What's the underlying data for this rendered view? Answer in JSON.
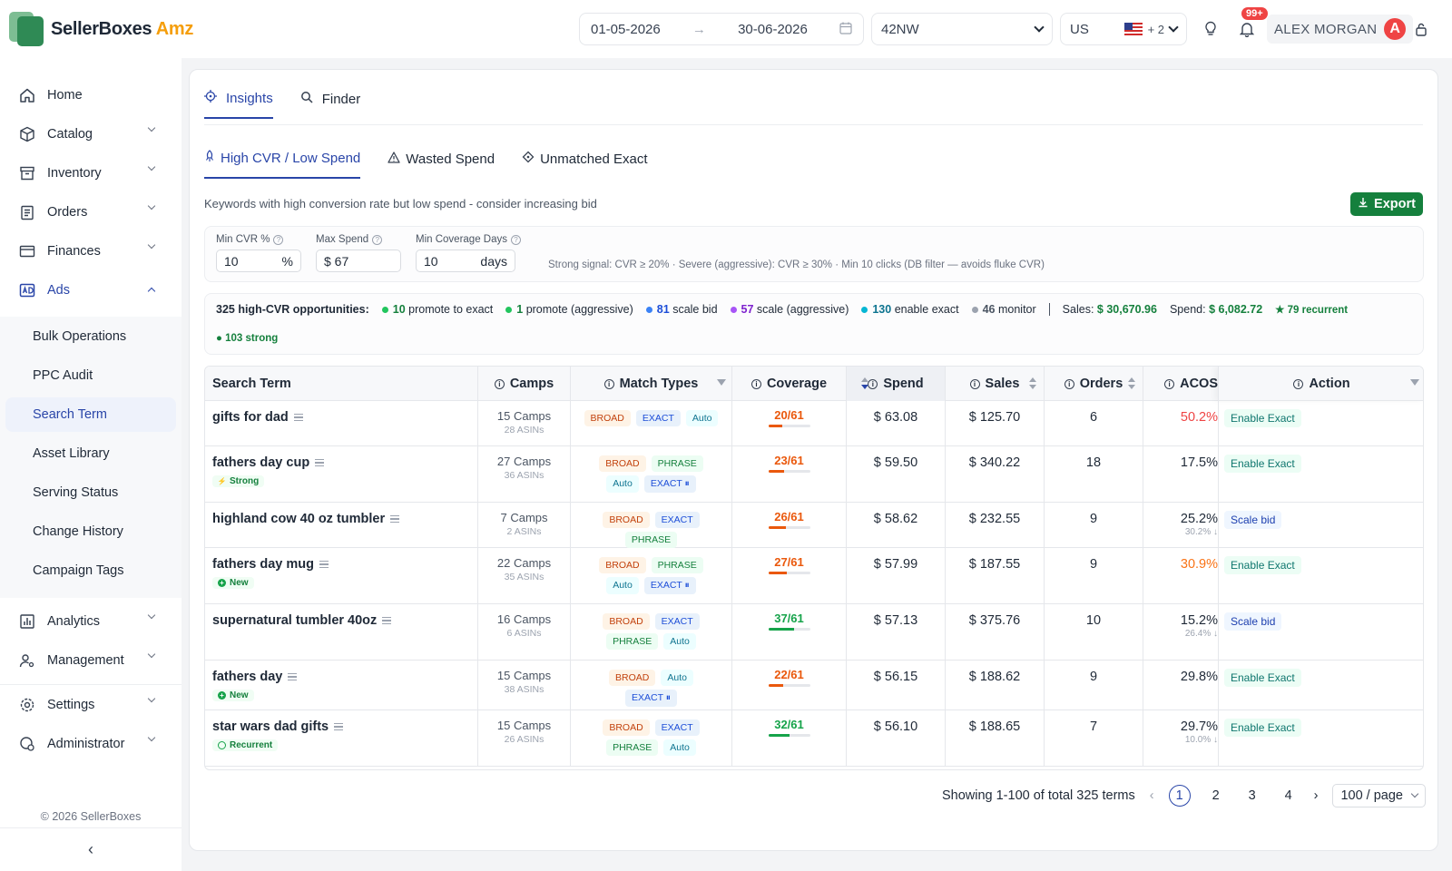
{
  "app": {
    "name_main": "SellerBoxes",
    "name_accent": "Amz"
  },
  "header": {
    "date_from": "01-05-2026",
    "date_to": "30-06-2026",
    "store": "42NW",
    "marketplace": "US",
    "extra_markets": "+ 2",
    "notifications": "99+",
    "user_name": "ALEX MORGAN",
    "avatar_letter": "A"
  },
  "sidebar": {
    "items": [
      {
        "label": "Home",
        "icon": "home-icon"
      },
      {
        "label": "Catalog",
        "icon": "cube-icon"
      },
      {
        "label": "Inventory",
        "icon": "archive-icon"
      },
      {
        "label": "Orders",
        "icon": "clipboard-icon"
      },
      {
        "label": "Finances",
        "icon": "card-icon"
      },
      {
        "label": "Ads",
        "icon": "ad-icon"
      }
    ],
    "ads_sub": [
      "Bulk Operations",
      "PPC Audit",
      "Search Term",
      "Asset Library",
      "Serving Status",
      "Change History",
      "Campaign Tags"
    ],
    "lower": [
      {
        "label": "Analytics"
      },
      {
        "label": "Management"
      },
      {
        "label": "Settings"
      },
      {
        "label": "Administrator"
      }
    ],
    "copyright": "© 2026 SellerBoxes"
  },
  "tabs": {
    "primary": [
      "Insights",
      "Finder"
    ],
    "secondary": [
      "High CVR / Low Spend",
      "Wasted Spend",
      "Unmatched Exact"
    ]
  },
  "description": "Keywords with high conversion rate but low spend - consider increasing bid",
  "export_label": "Export",
  "filters": {
    "min_cvr_label": "Min CVR %",
    "min_cvr": "10",
    "min_cvr_unit": "%",
    "max_spend_label": "Max Spend",
    "max_spend": "$ 67",
    "min_cov_label": "Min Coverage Days",
    "min_cov": "10",
    "min_cov_unit": "days",
    "signal": "Strong signal: CVR ≥ 20% · Severe (aggressive): CVR ≥ 30% · Min 10 clicks (DB filter — avoids fluke CVR)"
  },
  "summary": {
    "count_label": "325 high-CVR opportunities:",
    "cats": [
      {
        "n": "10",
        "label": "promote to exact",
        "color": "#22c55e"
      },
      {
        "n": "1",
        "label": "promote (aggressive)",
        "color": "#22c55e"
      },
      {
        "n": "81",
        "label": "scale bid",
        "color": "#3b82f6"
      },
      {
        "n": "57",
        "label": "scale (aggressive)",
        "color": "#a855f7"
      },
      {
        "n": "130",
        "label": "enable exact",
        "color": "#06b6d4"
      },
      {
        "n": "46",
        "label": "monitor",
        "color": "#9ca3af"
      }
    ],
    "sales_label": "Sales:",
    "sales": "$ 30,670.96",
    "spend_label": "Spend:",
    "spend": "$ 6,082.72",
    "recurrent": "★ 79 recurrent",
    "strong": "● 103 strong"
  },
  "columns": {
    "term": "Search Term",
    "camps": "Camps",
    "match": "Match Types",
    "coverage": "Coverage",
    "spend": "Spend",
    "sales": "Sales",
    "orders": "Orders",
    "acos": "ACOS",
    "action": "Action"
  },
  "rows": [
    {
      "term": "gifts for dad",
      "tag": "",
      "camps": "15 Camps",
      "asins": "28 ASINs",
      "types": [
        [
          "BROAD",
          "broad"
        ],
        [
          "EXACT",
          "exact"
        ],
        [
          "Auto",
          "auto"
        ]
      ],
      "cov": "20/61",
      "cov_frac": 0.33,
      "cov_color": "#ea580c",
      "spend": "$ 63.08",
      "sales": "$ 125.70",
      "orders": "6",
      "acos": "50.2%",
      "acos_color": "#ef4444",
      "acos_sub": "",
      "action": "Enable Exact",
      "act": "enable"
    },
    {
      "term": "fathers day cup",
      "tag": "Strong",
      "camps": "27 Camps",
      "asins": "36 ASINs",
      "types": [
        [
          "BROAD",
          "broad"
        ],
        [
          "PHRASE",
          "phrase"
        ],
        [
          "Auto",
          "auto"
        ],
        [
          "EXACT ⏸",
          "exact"
        ]
      ],
      "cov": "23/61",
      "cov_frac": 0.38,
      "cov_color": "#ea580c",
      "spend": "$ 59.50",
      "sales": "$ 340.22",
      "orders": "18",
      "acos": "17.5%",
      "acos_color": "#1f2937",
      "acos_sub": "",
      "action": "Enable Exact",
      "act": "enable"
    },
    {
      "term": "highland cow 40 oz tumbler",
      "tag": "",
      "camps": "7 Camps",
      "asins": "2 ASINs",
      "types": [
        [
          "BROAD",
          "broad"
        ],
        [
          "EXACT",
          "exact"
        ],
        [
          "PHRASE",
          "phrase"
        ]
      ],
      "cov": "26/61",
      "cov_frac": 0.43,
      "cov_color": "#ea580c",
      "spend": "$ 58.62",
      "sales": "$ 232.55",
      "orders": "9",
      "acos": "25.2%",
      "acos_color": "#1f2937",
      "acos_sub": "30.2% ↓",
      "action": "Scale bid",
      "act": "scale"
    },
    {
      "term": "fathers day mug",
      "tag": "New",
      "camps": "22 Camps",
      "asins": "35 ASINs",
      "types": [
        [
          "BROAD",
          "broad"
        ],
        [
          "PHRASE",
          "phrase"
        ],
        [
          "Auto",
          "auto"
        ],
        [
          "EXACT ⏸",
          "exact"
        ]
      ],
      "cov": "27/61",
      "cov_frac": 0.44,
      "cov_color": "#ea580c",
      "spend": "$ 57.99",
      "sales": "$ 187.55",
      "orders": "9",
      "acos": "30.9%",
      "acos_color": "#f97316",
      "acos_sub": "",
      "action": "Enable Exact",
      "act": "enable"
    },
    {
      "term": "supernatural tumbler 40oz",
      "tag": "",
      "camps": "16 Camps",
      "asins": "6 ASINs",
      "types": [
        [
          "BROAD",
          "broad"
        ],
        [
          "EXACT",
          "exact"
        ],
        [
          "PHRASE",
          "phrase"
        ],
        [
          "Auto",
          "auto"
        ]
      ],
      "cov": "37/61",
      "cov_frac": 0.61,
      "cov_color": "#16a34a",
      "spend": "$ 57.13",
      "sales": "$ 375.76",
      "orders": "10",
      "acos": "15.2%",
      "acos_color": "#1f2937",
      "acos_sub": "26.4% ↓",
      "action": "Scale bid",
      "act": "scale"
    },
    {
      "term": "fathers day",
      "tag": "New",
      "camps": "15 Camps",
      "asins": "38 ASINs",
      "types": [
        [
          "BROAD",
          "broad"
        ],
        [
          "Auto",
          "auto"
        ],
        [
          "EXACT ⏸",
          "exact"
        ]
      ],
      "cov": "22/61",
      "cov_frac": 0.36,
      "cov_color": "#ea580c",
      "spend": "$ 56.15",
      "sales": "$ 188.62",
      "orders": "9",
      "acos": "29.8%",
      "acos_color": "#1f2937",
      "acos_sub": "",
      "action": "Enable Exact",
      "act": "enable"
    },
    {
      "term": "star wars dad gifts",
      "tag": "Recurrent",
      "camps": "15 Camps",
      "asins": "26 ASINs",
      "types": [
        [
          "BROAD",
          "broad"
        ],
        [
          "EXACT",
          "exact"
        ],
        [
          "PHRASE",
          "phrase"
        ],
        [
          "Auto",
          "auto"
        ]
      ],
      "cov": "32/61",
      "cov_frac": 0.52,
      "cov_color": "#16a34a",
      "spend": "$ 56.10",
      "sales": "$ 188.65",
      "orders": "7",
      "acos": "29.7%",
      "acos_color": "#1f2937",
      "acos_sub": "10.0% ↓",
      "action": "Enable Exact",
      "act": "enable"
    }
  ],
  "pager": {
    "showing": "Showing 1-100 of total 325 terms",
    "pages": [
      "1",
      "2",
      "3",
      "4"
    ],
    "page_size": "100 / page"
  }
}
